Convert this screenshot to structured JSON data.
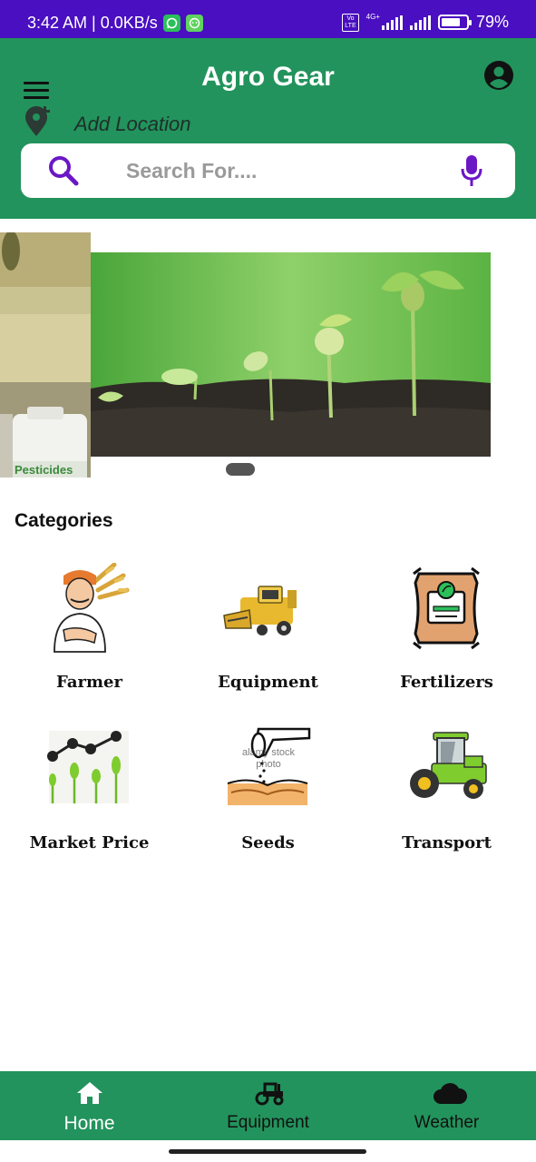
{
  "status_bar": {
    "time": "3:42 AM | 0.0KB/s",
    "network": "4G+",
    "battery": "79%"
  },
  "header": {
    "title": "Agro Gear",
    "location_label": "Add Location",
    "search_placeholder": "Search For...."
  },
  "banner": {
    "side_text": "Pesticides",
    "slide_count": 2,
    "active_slide": 2
  },
  "categories": {
    "title": "Categories",
    "items": [
      {
        "label": "Farmer"
      },
      {
        "label": "Equipment"
      },
      {
        "label": "Fertilizers"
      },
      {
        "label": "Market Price"
      },
      {
        "label": "Seeds",
        "watermark": "alamy stock photo"
      },
      {
        "label": "Transport"
      }
    ]
  },
  "bottom_nav": {
    "items": [
      {
        "label": "Home",
        "active": true
      },
      {
        "label": "Equipment",
        "active": false
      },
      {
        "label": "Weather",
        "active": false
      }
    ]
  },
  "colors": {
    "status_bar": "#4a0fc0",
    "primary_green": "#22935c",
    "search_accent": "#6b17c6"
  },
  "icons": [
    "whatsapp-icon",
    "messenger-icon",
    "menu-icon",
    "account-icon",
    "add-location-icon",
    "search-icon",
    "mic-icon",
    "home-icon",
    "tractor-icon",
    "cloud-icon"
  ]
}
